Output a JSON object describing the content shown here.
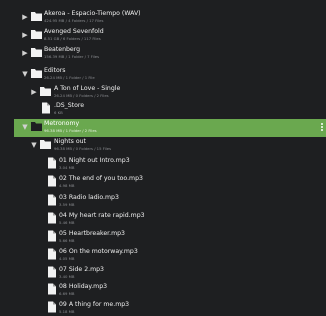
{
  "colors": {
    "background": "#1e1f21",
    "selected_row": "#6aa84f",
    "text_primary": "#f0f0f0",
    "text_secondary": "#8a8c90",
    "folder_icon": "#f2f2f2",
    "file_icon": "#f2f2f2"
  },
  "tree": {
    "rows": [
      {
        "name": "Akeroa - Espacio-Tiempo (WAV)",
        "meta": "424.95 MB / 4 Folders / 17 Files",
        "icon": "folder-icon",
        "chevron": "chevron-right-icon"
      },
      {
        "name": "Avenged Sevenfold",
        "meta": "8.51 GB / 6 Folders / 117 Files",
        "icon": "folder-icon",
        "chevron": "chevron-right-icon"
      },
      {
        "name": "Beatenberg",
        "meta": "156.39 MB / 1 Folder / 7 Files",
        "icon": "folder-icon",
        "chevron": "chevron-right-icon"
      },
      {
        "name": "Editors",
        "meta": "26.24 MB / 1 Folder / 1 File",
        "icon": "folder-icon",
        "chevron": "chevron-down-icon"
      },
      {
        "name": "A Ton of Love - Single",
        "meta": "26.24 MB / 0 Folders / 2 Files",
        "icon": "folder-icon",
        "chevron": "chevron-right-icon"
      },
      {
        "name": ".DS_Store",
        "meta": "6 KB",
        "icon": "file-icon"
      },
      {
        "name": "Metronomy",
        "meta": "96.38 MB / 1 Folder / 2 Files",
        "icon": "folder-icon",
        "chevron": "chevron-down-icon",
        "selected": true
      },
      {
        "name": "Nights out",
        "meta": "96.38 MB / 0 Folders / 15 Files",
        "icon": "folder-icon",
        "chevron": "chevron-down-icon"
      },
      {
        "name": "01 Night out Intro.mp3",
        "meta": "3.04 MB",
        "icon": "file-icon"
      },
      {
        "name": "02 The end of you too.mp3",
        "meta": "4.98 MB",
        "icon": "file-icon"
      },
      {
        "name": "03 Radio ladio.mp3",
        "meta": "3.59 MB",
        "icon": "file-icon"
      },
      {
        "name": "04 My heart rate rapid.mp3",
        "meta": "5.46 MB",
        "icon": "file-icon"
      },
      {
        "name": "05 Heartbreaker.mp3",
        "meta": "5.66 MB",
        "icon": "file-icon"
      },
      {
        "name": "06 On the motorway.mp3",
        "meta": "4.05 MB",
        "icon": "file-icon"
      },
      {
        "name": "07 Side 2.mp3",
        "meta": "3.40 MB",
        "icon": "file-icon"
      },
      {
        "name": "08 Holiday.mp3",
        "meta": "6.69 MB",
        "icon": "file-icon"
      },
      {
        "name": "09 A thing for me.mp3",
        "meta": "5.18 MB",
        "icon": "file-icon"
      }
    ],
    "more_menu_icon": "more-vertical-icon"
  }
}
